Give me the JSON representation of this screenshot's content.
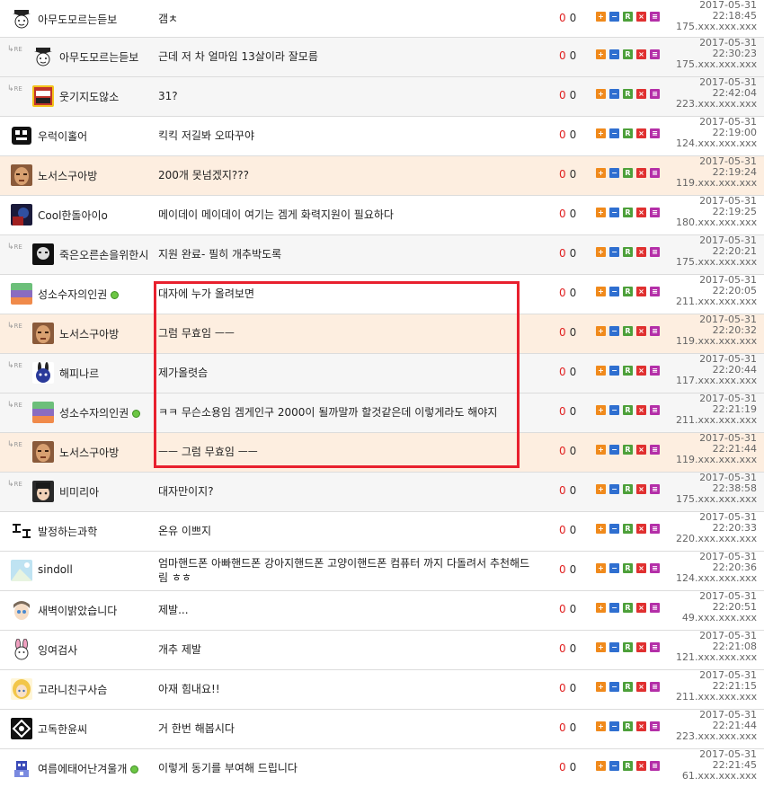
{
  "reply_label": "RE",
  "highlight_color": "#e8202e",
  "comments": [
    {
      "nick": "아무도모르는듣보",
      "avatar": "cap-avatar",
      "reply": false,
      "online": false,
      "style": "normal",
      "message": "갬ㅊ",
      "up": "0",
      "down": "0",
      "date": "2017-05-31",
      "time": "22:18:45",
      "ip": "175.xxx.xxx.xxx"
    },
    {
      "nick": "아무도모르는듣보",
      "avatar": "cap-avatar",
      "reply": true,
      "online": false,
      "style": "reply",
      "message": "근데 저 차 얼마임 13살이라 잘모름",
      "up": "0",
      "down": "0",
      "date": "2017-05-31",
      "time": "22:30:23",
      "ip": "175.xxx.xxx.xxx"
    },
    {
      "nick": "웃기지도않소",
      "avatar": "badge-avatar",
      "reply": true,
      "online": false,
      "style": "reply",
      "message": "31?",
      "up": "0",
      "down": "0",
      "date": "2017-05-31",
      "time": "22:42:04",
      "ip": "223.xxx.xxx.xxx"
    },
    {
      "nick": "우럭이홀어",
      "avatar": "text-avatar",
      "reply": false,
      "online": false,
      "style": "normal",
      "message": "킥킥 저길봐 오따꾸야",
      "up": "0",
      "down": "0",
      "date": "2017-05-31",
      "time": "22:19:00",
      "ip": "124.xxx.xxx.xxx"
    },
    {
      "nick": "노서스구아방",
      "avatar": "face-avatar",
      "reply": false,
      "online": false,
      "style": "hl",
      "message": "200개 못넘겠지???",
      "up": "0",
      "down": "0",
      "date": "2017-05-31",
      "time": "22:19:24",
      "ip": "119.xxx.xxx.xxx"
    },
    {
      "nick": "Cool한돌아이o",
      "avatar": "dark-avatar",
      "reply": false,
      "online": false,
      "style": "normal",
      "message": "메이데이 메이데이 여기는 겜게 화력지원이 필요하다",
      "up": "0",
      "down": "0",
      "date": "2017-05-31",
      "time": "22:19:25",
      "ip": "180.xxx.xxx.xxx"
    },
    {
      "nick": "죽은오른손을위한시",
      "avatar": "bw-avatar",
      "reply": true,
      "online": false,
      "style": "reply",
      "message": "지원 완료- 필히 개추박도록",
      "up": "0",
      "down": "0",
      "date": "2017-05-31",
      "time": "22:20:21",
      "ip": "175.xxx.xxx.xxx"
    },
    {
      "nick": "성소수자의인권",
      "avatar": "stripe-avatar",
      "reply": false,
      "online": true,
      "style": "normal",
      "message": "대자에 누가 올려보면",
      "up": "0",
      "down": "0",
      "date": "2017-05-31",
      "time": "22:20:05",
      "ip": "211.xxx.xxx.xxx"
    },
    {
      "nick": "노서스구아방",
      "avatar": "face-avatar",
      "reply": true,
      "online": false,
      "style": "hl",
      "message": "그럼 무효임 ㅡㅡ",
      "up": "0",
      "down": "0",
      "date": "2017-05-31",
      "time": "22:20:32",
      "ip": "119.xxx.xxx.xxx"
    },
    {
      "nick": "해피나르",
      "avatar": "rabbit-avatar",
      "reply": true,
      "online": false,
      "style": "reply",
      "message": "제가올렷슴",
      "up": "0",
      "down": "0",
      "date": "2017-05-31",
      "time": "22:20:44",
      "ip": "117.xxx.xxx.xxx"
    },
    {
      "nick": "성소수자의인권",
      "avatar": "stripe-avatar",
      "reply": true,
      "online": true,
      "style": "reply",
      "message": "ㅋㅋ 무슨소용임 겜게인구 2000이 될까말까 할것같은데 이렇게라도 해야지",
      "up": "0",
      "down": "0",
      "date": "2017-05-31",
      "time": "22:21:19",
      "ip": "211.xxx.xxx.xxx"
    },
    {
      "nick": "노서스구아방",
      "avatar": "face-avatar",
      "reply": true,
      "online": false,
      "style": "hl",
      "message": "ㅡㅡ 그럼 무효임 ㅡㅡ",
      "up": "0",
      "down": "0",
      "date": "2017-05-31",
      "time": "22:21:44",
      "ip": "119.xxx.xxx.xxx"
    },
    {
      "nick": "비미리아",
      "avatar": "girl-avatar",
      "reply": true,
      "online": false,
      "style": "reply",
      "message": "대자만이지?",
      "up": "0",
      "down": "0",
      "date": "2017-05-31",
      "time": "22:38:58",
      "ip": "175.xxx.xxx.xxx"
    },
    {
      "nick": "발정하는과학",
      "avatar": "text-avatar-2",
      "reply": false,
      "online": false,
      "style": "normal",
      "message": "온유 이쁘지",
      "up": "0",
      "down": "0",
      "date": "2017-05-31",
      "time": "22:20:33",
      "ip": "220.xxx.xxx.xxx"
    },
    {
      "nick": "sindoll",
      "avatar": "sky-avatar",
      "reply": false,
      "online": false,
      "style": "normal",
      "message": "엄마핸드폰 아빠핸드폰 강아지핸드폰 고양이핸드폰 컴퓨터 까지 다돌려서 추천해드림 ㅎㅎ",
      "up": "0",
      "down": "0",
      "date": "2017-05-31",
      "time": "22:20:36",
      "ip": "124.xxx.xxx.xxx"
    },
    {
      "nick": "새벽이밝았습니다",
      "avatar": "anime-avatar",
      "reply": false,
      "online": false,
      "style": "normal",
      "message": "제발...",
      "up": "0",
      "down": "0",
      "date": "2017-05-31",
      "time": "22:20:51",
      "ip": "49.xxx.xxx.xxx"
    },
    {
      "nick": "잉여검사",
      "avatar": "bunny-avatar",
      "reply": false,
      "online": false,
      "style": "normal",
      "message": "개추 제발",
      "up": "0",
      "down": "0",
      "date": "2017-05-31",
      "time": "22:21:08",
      "ip": "121.xxx.xxx.xxx"
    },
    {
      "nick": "고라니친구사슴",
      "avatar": "blonde-avatar",
      "reply": false,
      "online": false,
      "style": "normal",
      "message": "아재 힘내요!!",
      "up": "0",
      "down": "0",
      "date": "2017-05-31",
      "time": "22:21:15",
      "ip": "211.xxx.xxx.xxx"
    },
    {
      "nick": "고독한윤씨",
      "avatar": "logo-avatar",
      "reply": false,
      "online": false,
      "style": "normal",
      "message": "거 한번 해봅시다",
      "up": "0",
      "down": "0",
      "date": "2017-05-31",
      "time": "22:21:44",
      "ip": "223.xxx.xxx.xxx"
    },
    {
      "nick": "여름에태어난겨울개",
      "avatar": "pixel-avatar",
      "reply": false,
      "online": true,
      "style": "normal",
      "message": "이렇게 동기를 부여해 드립니다",
      "up": "0",
      "down": "0",
      "date": "2017-05-31",
      "time": "22:21:45",
      "ip": "61.xxx.xxx.xxx"
    }
  ]
}
